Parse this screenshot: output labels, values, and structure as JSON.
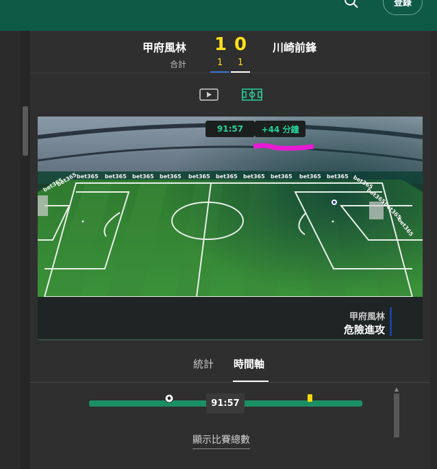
{
  "header": {
    "login_label": "登錄"
  },
  "scoreboard": {
    "home_team": "甲府風林",
    "away_team": "川崎前鋒",
    "home_score": "1",
    "away_score": "0",
    "total_label": "合計",
    "home_total": "1",
    "away_total": "1"
  },
  "view_modes": [
    "video-icon",
    "pitch-icon"
  ],
  "match_viz": {
    "clock": "91:57",
    "added_time": "+44 分鐘",
    "board_text": "bet365",
    "event_team": "甲府風林",
    "event_text": "危險進攻",
    "colors": {
      "home_team": "#1f3f99",
      "highlight": "#e81ad4",
      "pitch": "#2e7d33"
    }
  },
  "tabs": [
    {
      "label": "統計",
      "active": false
    },
    {
      "label": "時間軸",
      "active": true
    }
  ],
  "timeline": {
    "current_time": "91:57",
    "events": [
      "goal-ball-icon",
      "yellow-card-icon"
    ]
  },
  "footer": {
    "show_totals_label": "顯示比賽總數"
  },
  "theme": {
    "brand_green": "#0f5a45",
    "accent_yellow": "#ffdf1b",
    "timeline_green": "#1b8f64"
  }
}
